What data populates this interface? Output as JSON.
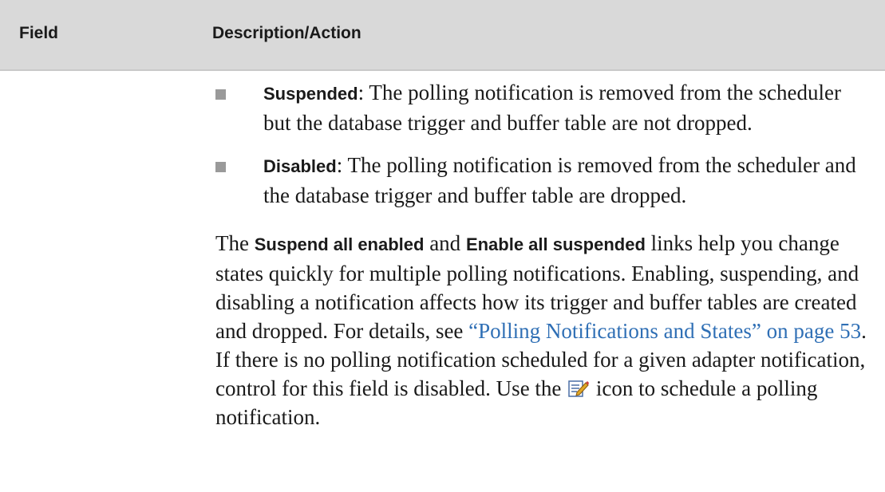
{
  "table": {
    "headers": {
      "field": "Field",
      "description": "Description/Action"
    },
    "bullets": [
      {
        "term": "Suspended",
        "text": ": The polling notification is removed from the scheduler but the database trigger and buffer table are not dropped."
      },
      {
        "term": "Disabled",
        "text": ": The polling notification is removed from the scheduler and the database trigger and buffer table are dropped."
      }
    ],
    "paragraph": {
      "p1": "The ",
      "term1": "Suspend all enabled",
      "p2": " and ",
      "term2": "Enable all suspended",
      "p3": " links help you change states quickly for multiple polling notifications. Enabling, suspending, and disabling a notification affects how its trigger and buffer tables are created and dropped. For details, see ",
      "link": "“Polling Notifications and States” on page 53",
      "p4": ". If there is no polling notification scheduled for a given adapter notification, control for this field is disabled. Use the ",
      "icon": "edit-schedule-icon",
      "p5": " icon to schedule a polling notification."
    }
  },
  "colors": {
    "header_bg": "#d9d9d9",
    "bullet": "#9a9a9a",
    "link": "#2f6fb5",
    "text": "#1a1a1a"
  }
}
